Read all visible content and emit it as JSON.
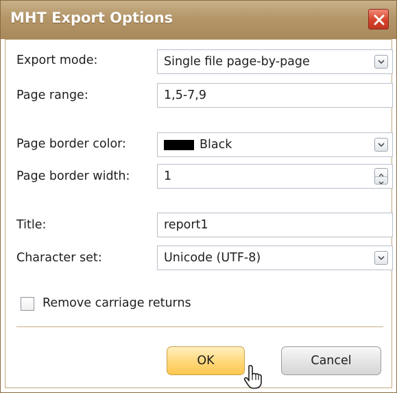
{
  "window": {
    "title": "MHT Export Options"
  },
  "form": {
    "export_mode": {
      "label": "Export mode:",
      "value": "Single file page-by-page"
    },
    "page_range": {
      "label": "Page range:",
      "value": "1,5-7,9"
    },
    "page_border_color": {
      "label": "Page border color:",
      "value": "Black",
      "swatch_color": "#000000"
    },
    "page_border_width": {
      "label": "Page border width:",
      "value": "1"
    },
    "title": {
      "label": "Title:",
      "value": "report1"
    },
    "character_set": {
      "label": "Character set:",
      "value": "Unicode (UTF-8)"
    },
    "remove_carriage_returns": {
      "label": "Remove carriage returns",
      "checked": false
    }
  },
  "buttons": {
    "ok": "OK",
    "cancel": "Cancel"
  },
  "colors": {
    "titlebar": "#b49669",
    "close": "#d6432c",
    "ok_button": "#ffd778",
    "frame_border": "#c2a77e"
  },
  "icons": [
    "close-icon",
    "chevron-down-icon",
    "spin-up-icon",
    "spin-down-icon",
    "mouse-pointer-icon"
  ]
}
